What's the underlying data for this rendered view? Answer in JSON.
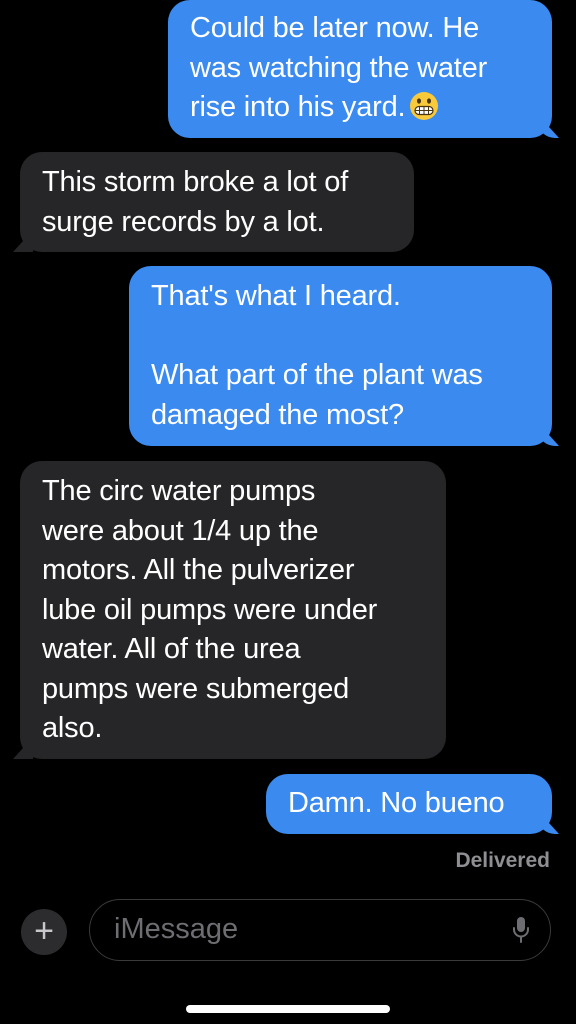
{
  "messages": [
    {
      "direction": "sent",
      "text": "Could be later now. He\nwas watching the water\nrise into his yard.",
      "emoji": "grimacing-face-emoji"
    },
    {
      "direction": "received",
      "text": "This storm broke a lot of\nsurge records by a lot."
    },
    {
      "direction": "sent",
      "text": "That's what I heard.\n\nWhat part of the plant was\ndamaged the most?"
    },
    {
      "direction": "received",
      "text": "The circ water pumps\nwere about 1/4 up the\nmotors. All the pulverizer\nlube oil pumps were under\nwater. All of the urea\npumps were submerged\nalso."
    },
    {
      "direction": "sent",
      "text": "Damn. No bueno"
    }
  ],
  "status": {
    "delivered": "Delivered"
  },
  "composer": {
    "plus_icon": "plus-icon",
    "plus_glyph": "+",
    "placeholder": "iMessage",
    "mic_icon": "microphone-icon"
  },
  "colors": {
    "background": "#000000",
    "sent_bubble": "#3b8af0",
    "received_bubble": "#262628",
    "status_text": "#8e8e93"
  }
}
